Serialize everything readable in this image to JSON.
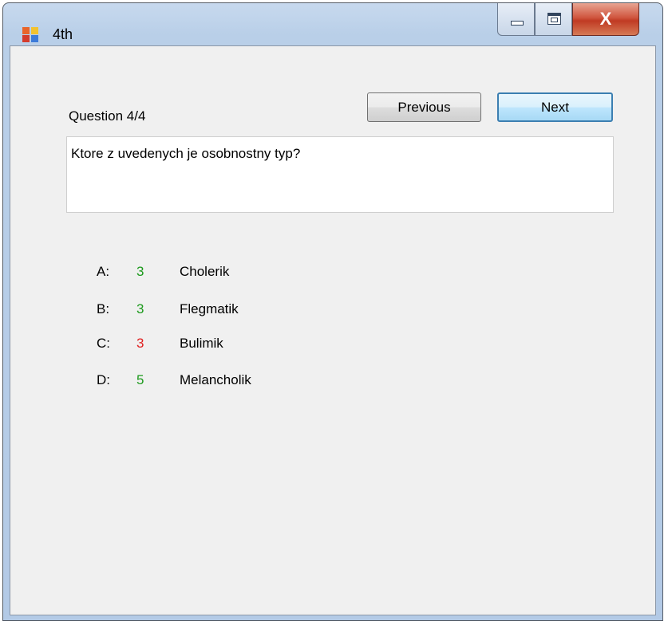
{
  "window": {
    "title": "4th",
    "close_glyph": "X"
  },
  "quiz": {
    "question_label": "Question 4/4",
    "previous_label": "Previous",
    "next_label": "Next",
    "question_text": "Ktore z uvedenych je osobnostny typ?",
    "answers": [
      {
        "letter": "A:",
        "count": "3",
        "text": "Cholerik",
        "count_color": "green"
      },
      {
        "letter": "B:",
        "count": "3",
        "text": "Flegmatik",
        "count_color": "green"
      },
      {
        "letter": "C:",
        "count": "3",
        "text": "Bulimik",
        "count_color": "red"
      },
      {
        "letter": "D:",
        "count": "5",
        "text": "Melancholik",
        "count_color": "green"
      }
    ]
  },
  "colors": {
    "green": "#1d9a1d",
    "red": "#e02020"
  }
}
